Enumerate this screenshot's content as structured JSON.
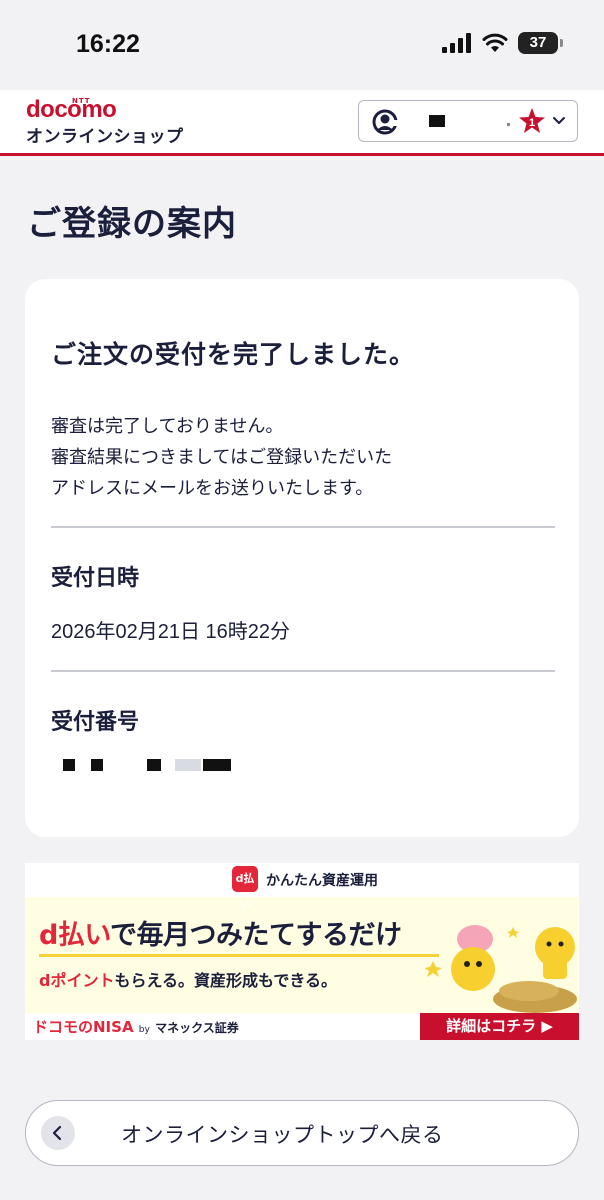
{
  "status_bar": {
    "time": "16:22",
    "battery": "37"
  },
  "header": {
    "logo_ntt": "NTT",
    "logo": "docomo",
    "logo_sub": "オンラインショップ",
    "cart_count": "1"
  },
  "page_title": "ご登録の案内",
  "card": {
    "heading": "ご注文の受付を完了しました。",
    "notice_lines": [
      "審査は完了しておりません。",
      "審査結果につきましてはご登録いただいた",
      "アドレスにメールをお送りいたします。"
    ],
    "received_at_label": "受付日時",
    "received_at_value": "2026年02月21日 16時22分",
    "receipt_number_label": "受付番号"
  },
  "banner": {
    "badge": "d払い",
    "top_text": "かんたん資産運用",
    "headline_red": "d払い",
    "headline_rest": "で毎月つみたてするだけ",
    "sub_red": "dポイント",
    "sub_rest": "もらえる。資産形成もできる。",
    "nisa_logo": "ドコモのNISA",
    "nisa_by": "by",
    "nisa_monex": "マネックス証券",
    "cta": "詳細はコチラ ▶"
  },
  "back_button": {
    "label": "オンラインショップトップへ戻る"
  },
  "colors": {
    "brand_red": "#c8102e",
    "navy_text": "#1b1f3b",
    "background": "#f2f2f4"
  },
  "icons": [
    "signal-icon",
    "wifi-icon",
    "battery-icon",
    "account-icon",
    "star-badge-icon",
    "chevron-down-icon",
    "chevron-left-icon"
  ]
}
